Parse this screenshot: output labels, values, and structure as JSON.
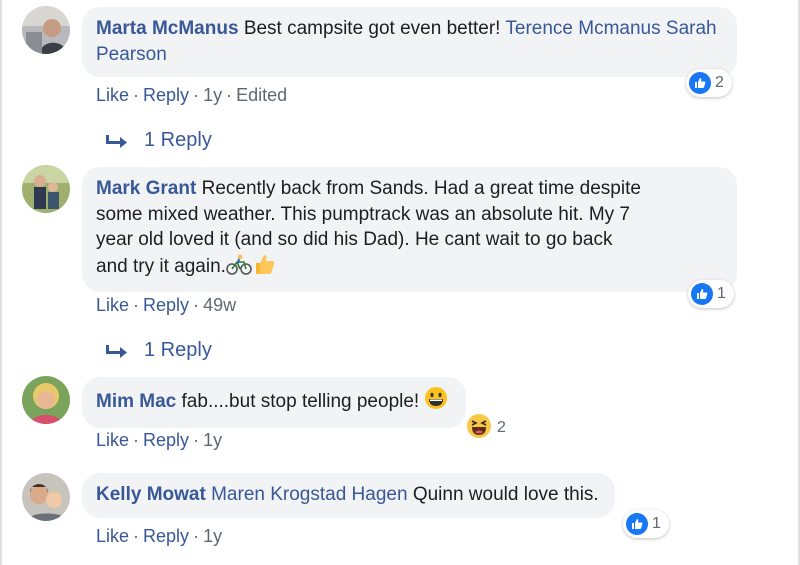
{
  "comments": [
    {
      "author": "Marta McManus",
      "text": "Best campsite got even better!",
      "mentions": "Terence Mcmanus Sarah Pearson",
      "like": "Like",
      "reply": "Reply",
      "time": "1y",
      "edited": "Edited",
      "reaction_count": "2",
      "replies_label": "1 Reply"
    },
    {
      "author": "Mark Grant",
      "text_line1": "Recently back from Sands. Had a great time despite",
      "text_line2": "some mixed weather. This pumptrack was an absolute hit. My 7",
      "text_line3": "year old loved it (and so did his Dad). He cant wait to go back",
      "text_line4": "and try it again.",
      "emojis": [
        "cyclist-emoji",
        "thumbs-up-emoji"
      ],
      "like": "Like",
      "reply": "Reply",
      "time": "49w",
      "reaction_count": "1",
      "replies_label": "1 Reply"
    },
    {
      "author": "Mim Mac",
      "text": "fab....but stop telling people!",
      "emoji": "grinning-emoji",
      "like": "Like",
      "reply": "Reply",
      "time": "1y",
      "reaction_count": "2",
      "reaction_type": "haha"
    },
    {
      "author": "Kelly Mowat",
      "mention": "Maren Krogstad Hagen",
      "text": "Quinn would love this.",
      "like": "Like",
      "reply": "Reply",
      "time": "1y",
      "reaction_count": "1"
    }
  ],
  "colors": {
    "link": "#385898",
    "meta": "#606770",
    "bubble": "#f2f3f5",
    "like_blue": "#1877f2",
    "text": "#1c1e21"
  }
}
